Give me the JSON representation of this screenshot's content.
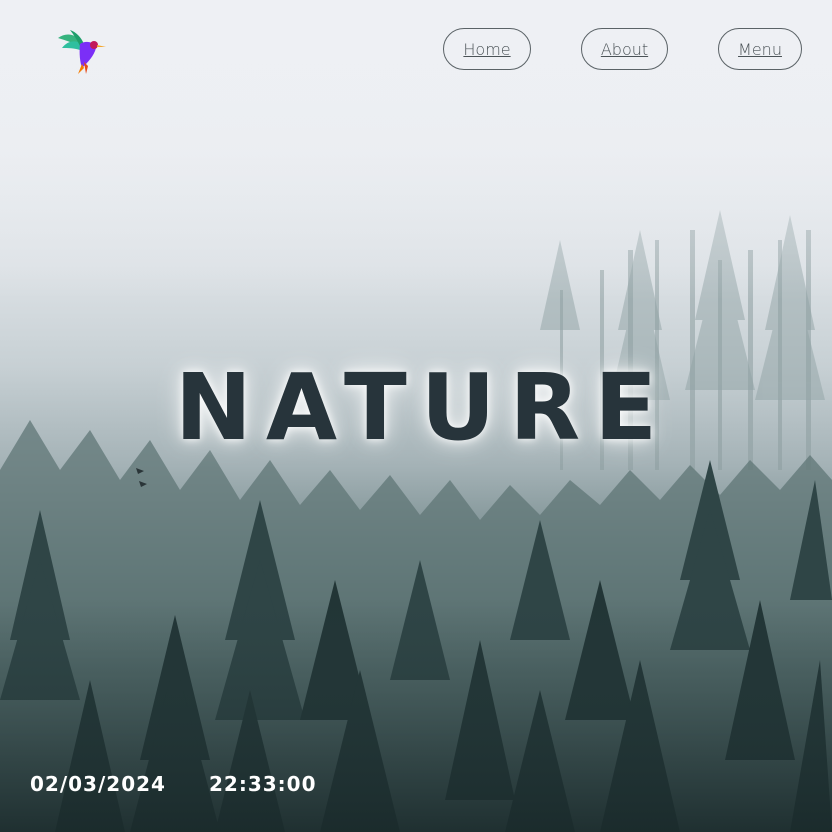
{
  "nav": {
    "home_label": "Home",
    "about_label": "About",
    "menu_label": "Menu"
  },
  "hero": {
    "title": "NATURE"
  },
  "footer": {
    "date": "02/03/2024",
    "time": "22:33:00"
  },
  "icons": {
    "logo": "hummingbird-logo-icon",
    "birds": "flying-birds-icon"
  },
  "colors": {
    "title": "#27343b",
    "nav_text": "#4a5256",
    "footer_text": "#ffffff",
    "fog_top": "#eef0f4",
    "forest_bottom": "#1c2d2e"
  }
}
